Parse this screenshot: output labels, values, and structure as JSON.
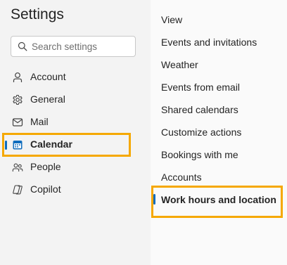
{
  "settings": {
    "title": "Settings",
    "search_placeholder": "Search settings"
  },
  "nav": {
    "items": [
      {
        "label": "Account",
        "icon": "person-icon",
        "selected": false
      },
      {
        "label": "General",
        "icon": "gear-icon",
        "selected": false
      },
      {
        "label": "Mail",
        "icon": "mail-icon",
        "selected": false
      },
      {
        "label": "Calendar",
        "icon": "calendar-icon",
        "selected": true
      },
      {
        "label": "People",
        "icon": "people-icon",
        "selected": false
      },
      {
        "label": "Copilot",
        "icon": "copilot-icon",
        "selected": false
      }
    ]
  },
  "calendar_settings": {
    "items": [
      {
        "label": "View",
        "selected": false
      },
      {
        "label": "Events and invitations",
        "selected": false
      },
      {
        "label": "Weather",
        "selected": false
      },
      {
        "label": "Events from email",
        "selected": false
      },
      {
        "label": "Shared calendars",
        "selected": false
      },
      {
        "label": "Customize actions",
        "selected": false
      },
      {
        "label": "Bookings with me",
        "selected": false
      },
      {
        "label": "Accounts",
        "selected": false
      },
      {
        "label": "Work hours and location",
        "selected": true
      }
    ]
  },
  "colors": {
    "accent": "#0f6cbd",
    "highlight_outline": "#f5a800",
    "calendar_icon": "#0f6cbd"
  }
}
